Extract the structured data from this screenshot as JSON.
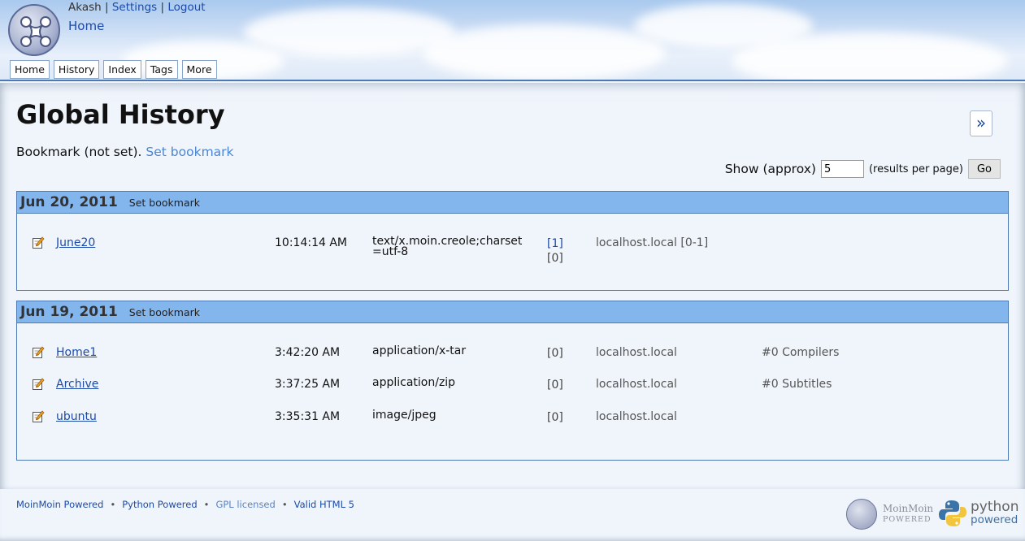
{
  "header": {
    "username": "Akash",
    "settings_label": "Settings",
    "logout_label": "Logout",
    "separator": "|",
    "home_link": "Home",
    "tabs": [
      {
        "label": "Home"
      },
      {
        "label": "History"
      },
      {
        "label": "Index"
      },
      {
        "label": "Tags"
      },
      {
        "label": "More"
      }
    ]
  },
  "main": {
    "title": "Global History",
    "expand_button": "»",
    "bookmark_text": "Bookmark (not set).",
    "set_bookmark_link": "Set bookmark",
    "show_label": "Show (approx)",
    "show_value": "5",
    "show_suffix": "(results per page)",
    "go_label": "Go",
    "days": [
      {
        "date": "Jun 20, 2011",
        "set_bookmark": "Set bookmark",
        "entries": [
          {
            "name": "June20",
            "time": "10:14:14 AM",
            "type": "text/x.moin.creole;charset=utf-8",
            "rev_link": "[1]",
            "rev": "[0]",
            "host": "localhost.local [0-1]",
            "comment": ""
          }
        ]
      },
      {
        "date": "Jun 19, 2011",
        "set_bookmark": "Set bookmark",
        "entries": [
          {
            "name": "Home1",
            "time": "3:42:20 AM",
            "type": "application/x-tar",
            "rev_link": "",
            "rev": "[0]",
            "host": "localhost.local",
            "comment": "#0 Compilers"
          },
          {
            "name": "Archive",
            "time": "3:37:25 AM",
            "type": "application/zip",
            "rev_link": "",
            "rev": "[0]",
            "host": "localhost.local",
            "comment": "#0 Subtitles"
          },
          {
            "name": "ubuntu",
            "time": "3:35:31 AM",
            "type": "image/jpeg",
            "rev_link": "",
            "rev": "[0]",
            "host": "localhost.local",
            "comment": ""
          }
        ]
      }
    ]
  },
  "footer": {
    "links": [
      "MoinMoin Powered",
      "Python Powered",
      "GPL licensed",
      "Valid HTML 5"
    ],
    "bullet": "•",
    "moin_badge_line1": "MoinMoin",
    "moin_badge_line2": "POWERED",
    "python_badge_line1": "python",
    "python_badge_line2": "powered"
  },
  "icons": {
    "logo": "moinmoin-logo-icon",
    "edit": "edit-page-icon",
    "python": "python-logo-icon"
  },
  "colors": {
    "day_header": "#84b6ee",
    "link": "#1b4aa8",
    "border": "#4d7ab4"
  }
}
